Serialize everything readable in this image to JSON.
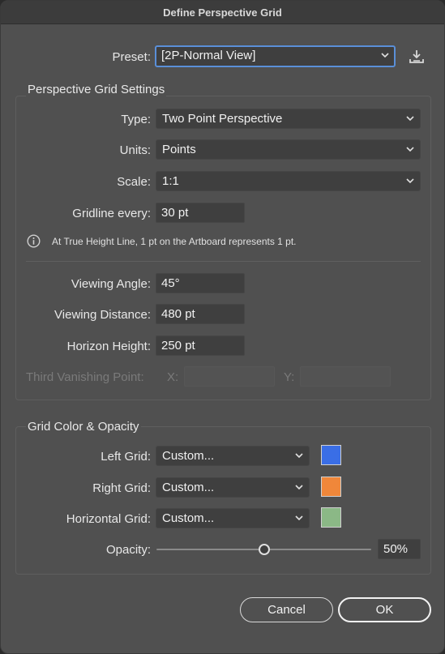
{
  "window": {
    "title": "Define Perspective Grid"
  },
  "preset": {
    "label": "Preset:",
    "value": "[2P-Normal View]",
    "icon": "save-preset-icon"
  },
  "settings": {
    "title": "Perspective Grid Settings",
    "type_label": "Type:",
    "type_value": "Two Point Perspective",
    "units_label": "Units:",
    "units_value": "Points",
    "scale_label": "Scale:",
    "scale_value": "1:1",
    "gridline_label": "Gridline every:",
    "gridline_value": "30 pt",
    "info_text": "At True Height Line, 1 pt on the Artboard represents 1 pt.",
    "angle_label": "Viewing Angle:",
    "angle_value": "45°",
    "distance_label": "Viewing Distance:",
    "distance_value": "480 pt",
    "horizon_label": "Horizon Height:",
    "horizon_value": "250 pt",
    "third_vp_label": "Third Vanishing Point:",
    "x_label": "X:",
    "x_value": "",
    "y_label": "Y:",
    "y_value": ""
  },
  "colors": {
    "title": "Grid Color & Opacity",
    "left_label": "Left Grid:",
    "left_value": "Custom...",
    "left_color": "#3a6ee6",
    "right_label": "Right Grid:",
    "right_value": "Custom...",
    "right_color": "#f0873a",
    "horizontal_label": "Horizontal Grid:",
    "horizontal_value": "Custom...",
    "horizontal_color": "#8bb886",
    "opacity_label": "Opacity:",
    "opacity_value": "50%",
    "opacity_fraction": 0.5
  },
  "buttons": {
    "cancel": "Cancel",
    "ok": "OK"
  }
}
